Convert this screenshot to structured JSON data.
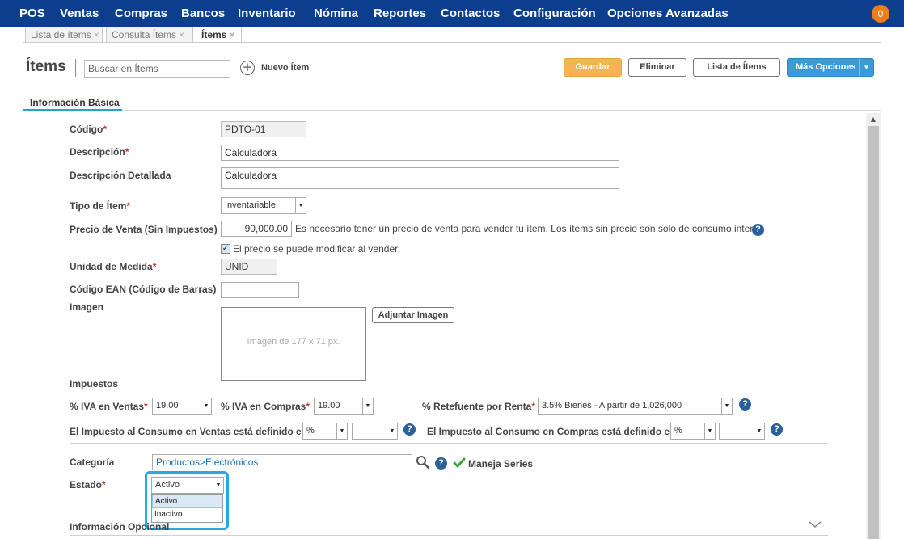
{
  "nav": {
    "items": [
      "POS",
      "Ventas",
      "Compras",
      "Bancos",
      "Inventario",
      "Nómina",
      "Reportes",
      "Contactos",
      "Configuración",
      "Opciones Avanzadas"
    ],
    "notifications": "0"
  },
  "tabs": [
    {
      "label": "Lista de ítems",
      "close": "×"
    },
    {
      "label": "Consulta Ítems",
      "close": "×"
    },
    {
      "label": "Ítems",
      "close": "×"
    }
  ],
  "header": {
    "title": "Ítems",
    "search_placeholder": "Buscar en Ítems",
    "new_item": "Nuevo Ítem",
    "save": "Guardar",
    "delete": "Eliminar",
    "list": "Lista de Ítems",
    "more": "Más Opciones"
  },
  "section_tab": "Información Básica",
  "form": {
    "codigo_label": "Código",
    "codigo": "PDTO-01",
    "descripcion_label": "Descripción",
    "descripcion": "Calculadora",
    "desc_det_label": "Descripción Detallada",
    "desc_det": "Calculadora",
    "tipo_label": "Tipo de Ítem",
    "tipo": "Inventariable",
    "precio_label": "Precio de Venta (Sin Impuestos)",
    "precio": "90,000.00",
    "precio_note": "Es necesario tener un precio de venta para vender tu ítem. Los ítems sin precio son solo de consumo interno",
    "precio_mod": "El precio se puede modificar al vender",
    "unidad_label": "Unidad de Medida",
    "unidad": "UNID",
    "ean_label": "Código EAN (Código de Barras)",
    "ean": "",
    "imagen_label": "Imagen",
    "imagen_placeholder": "Imagen de 177 x 71 px.",
    "adjuntar": "Adjuntar Imagen",
    "impuestos_label": "Impuestos",
    "iva_ventas_label": "% IVA en Ventas",
    "iva_ventas": "19.00",
    "iva_compras_label": "% IVA en Compras",
    "iva_compras": "19.00",
    "retefuente_label": "% Retefuente por Renta",
    "retefuente": "3.5% Bienes - A partir de 1,026,000",
    "consumo_ventas_label": "El Impuesto al Consumo en Ventas está definido en",
    "consumo_ventas_unit": "%",
    "consumo_ventas_val": "",
    "consumo_compras_label": "El Impuesto al Consumo en Compras está definido en",
    "consumo_compras_unit": "%",
    "consumo_compras_val": "",
    "categoria_label": "Categoría",
    "categoria": "Productos>Electrónicos",
    "maneja_series": "Maneja Series",
    "estado_label": "Estado",
    "estado": "Activo",
    "estado_options": [
      "Activo",
      "Inactivo"
    ],
    "opcional_label": "Información Opcional"
  },
  "req_mark": "*",
  "help_mark": "?"
}
